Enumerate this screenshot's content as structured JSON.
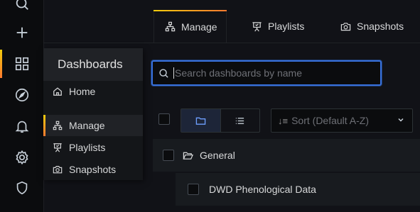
{
  "sidemenu": {
    "icons": [
      "search-icon",
      "plus-icon",
      "apps-icon",
      "compass-icon",
      "bell-icon",
      "gear-icon",
      "shield-icon"
    ]
  },
  "dropdown": {
    "title": "Dashboards",
    "items": [
      {
        "label": "Home",
        "icon": "home-icon"
      },
      {
        "label": "Manage",
        "icon": "sitemap-icon",
        "active": true
      },
      {
        "label": "Playlists",
        "icon": "presentation-icon"
      },
      {
        "label": "Snapshots",
        "icon": "camera-icon"
      }
    ]
  },
  "tabs": [
    {
      "label": "Manage",
      "icon": "sitemap-icon",
      "active": true
    },
    {
      "label": "Playlists",
      "icon": "presentation-icon"
    },
    {
      "label": "Snapshots",
      "icon": "camera-icon"
    }
  ],
  "search": {
    "placeholder": "Search dashboards by name",
    "value": ""
  },
  "toolbar": {
    "sort_label": "Sort (Default A-Z)",
    "view_modes": [
      "folder-view",
      "list-view"
    ]
  },
  "list": {
    "folder": {
      "label": "General",
      "icon": "folder-open-icon"
    },
    "dashboards": [
      {
        "label": "DWD Phenological Data"
      }
    ]
  },
  "colors": {
    "accent": "#3871dc",
    "active_gradient_start": "#f2cc0c",
    "active_gradient_end": "#ff7a2f"
  }
}
